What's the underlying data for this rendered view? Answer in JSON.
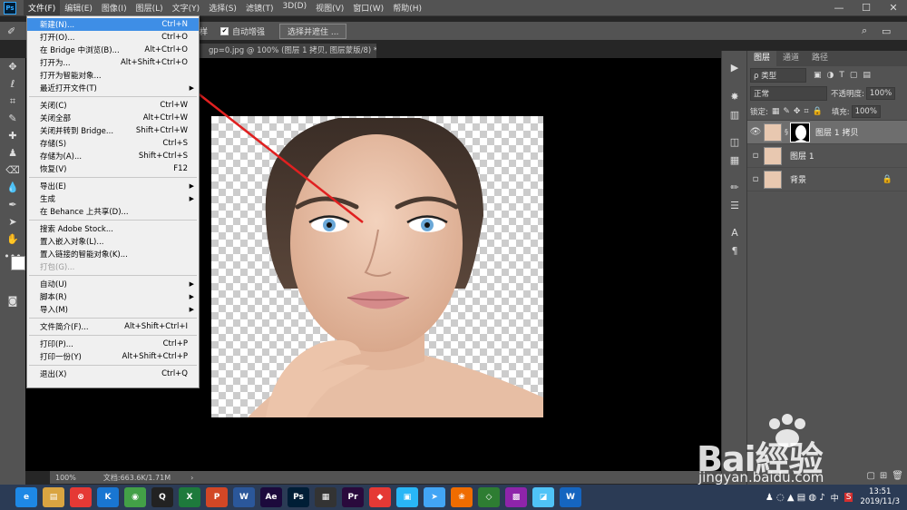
{
  "app": {
    "logo": "Ps",
    "menus": [
      "文件(F)",
      "编辑(E)",
      "图像(I)",
      "图层(L)",
      "文字(Y)",
      "选择(S)",
      "滤镜(T)",
      "3D(D)",
      "视图(V)",
      "窗口(W)",
      "帮助(H)"
    ],
    "window_controls": [
      "—",
      "☐",
      "✕"
    ]
  },
  "options": {
    "sample_label": "样",
    "auto_enhance_checked": "✔",
    "auto_enhance_label": "自动增强",
    "select_mask_button": "选择并遮住 ..."
  },
  "document": {
    "tab_title": "gp=0.jpg @ 100% (图层 1 拷贝, 图层蒙版/8) *",
    "tab_close": "×",
    "zoom": "100%",
    "doc_info": "文档:663.6K/1.71M",
    "status_arrow": "›"
  },
  "file_menu": {
    "items": [
      {
        "label": "新建(N)...",
        "shortcut": "Ctrl+N",
        "highlighted": true
      },
      {
        "label": "打开(O)...",
        "shortcut": "Ctrl+O"
      },
      {
        "label": "在 Bridge 中浏览(B)...",
        "shortcut": "Alt+Ctrl+O"
      },
      {
        "label": "打开为...",
        "shortcut": "Alt+Shift+Ctrl+O"
      },
      {
        "label": "打开为智能对象..."
      },
      {
        "label": "最近打开文件(T)",
        "submenu": true
      },
      {
        "separator": true
      },
      {
        "label": "关闭(C)",
        "shortcut": "Ctrl+W"
      },
      {
        "label": "关闭全部",
        "shortcut": "Alt+Ctrl+W"
      },
      {
        "label": "关闭并转到 Bridge...",
        "shortcut": "Shift+Ctrl+W"
      },
      {
        "label": "存储(S)",
        "shortcut": "Ctrl+S"
      },
      {
        "label": "存储为(A)...",
        "shortcut": "Shift+Ctrl+S"
      },
      {
        "label": "恢复(V)",
        "shortcut": "F12"
      },
      {
        "separator": true
      },
      {
        "label": "导出(E)",
        "submenu": true
      },
      {
        "label": "生成",
        "submenu": true
      },
      {
        "label": "在 Behance 上共享(D)..."
      },
      {
        "separator": true
      },
      {
        "label": "搜索 Adobe Stock..."
      },
      {
        "label": "置入嵌入对象(L)..."
      },
      {
        "label": "置入链接的智能对象(K)..."
      },
      {
        "label": "打包(G)...",
        "disabled": true
      },
      {
        "separator": true
      },
      {
        "label": "自动(U)",
        "submenu": true
      },
      {
        "label": "脚本(R)",
        "submenu": true
      },
      {
        "label": "导入(M)",
        "submenu": true
      },
      {
        "separator": true
      },
      {
        "label": "文件简介(F)...",
        "shortcut": "Alt+Shift+Ctrl+I"
      },
      {
        "separator": true
      },
      {
        "label": "打印(P)...",
        "shortcut": "Ctrl+P"
      },
      {
        "label": "打印一份(Y)",
        "shortcut": "Alt+Shift+Ctrl+P"
      },
      {
        "separator": true
      },
      {
        "label": "退出(X)",
        "shortcut": "Ctrl+Q"
      }
    ]
  },
  "layers_panel": {
    "tabs": [
      "图层",
      "通道",
      "路径"
    ],
    "filter_label": "ρ 类型",
    "blend_mode": "正常",
    "opacity_label": "不透明度:",
    "opacity_value": "100%",
    "lock_label": "锁定:",
    "fill_label": "填充:",
    "fill_value": "100%",
    "layers": [
      {
        "name": "图层 1 拷贝",
        "visible": true,
        "selected": true,
        "has_mask": true
      },
      {
        "name": "图层 1",
        "visible": false
      },
      {
        "name": "背景",
        "visible": false,
        "locked": true
      }
    ]
  },
  "taskbar": {
    "apps": [
      {
        "label": "e",
        "color": "#1e88e5"
      },
      {
        "label": "▤",
        "color": "#d9a441"
      },
      {
        "label": "⊗",
        "color": "#e53935"
      },
      {
        "label": "K",
        "color": "#1976d2"
      },
      {
        "label": "◉",
        "color": "#43a047"
      },
      {
        "label": "Q",
        "color": "#222222"
      },
      {
        "label": "X",
        "color": "#1e7a3c"
      },
      {
        "label": "P",
        "color": "#d24726"
      },
      {
        "label": "W",
        "color": "#2b579a"
      },
      {
        "label": "Ae",
        "color": "#1c0a3c"
      },
      {
        "label": "Ps",
        "color": "#001e36"
      },
      {
        "label": "▦",
        "color": "#333333"
      },
      {
        "label": "Pr",
        "color": "#2a0a3c"
      },
      {
        "label": "◆",
        "color": "#e53935"
      },
      {
        "label": "▣",
        "color": "#29b6f6"
      },
      {
        "label": "➤",
        "color": "#42a5f5"
      },
      {
        "label": "❀",
        "color": "#ef6c00"
      },
      {
        "label": "◇",
        "color": "#2e7d32"
      },
      {
        "label": "▩",
        "color": "#8e24aa"
      },
      {
        "label": "◪",
        "color": "#4fc3f7"
      },
      {
        "label": "W",
        "color": "#1565c0"
      }
    ],
    "tray_lang": "中",
    "tray_s": "S",
    "time": "13:51",
    "date": "2019/11/3"
  },
  "watermark": {
    "brand": "Bai經验",
    "url": "jingyan.baidu.com"
  }
}
